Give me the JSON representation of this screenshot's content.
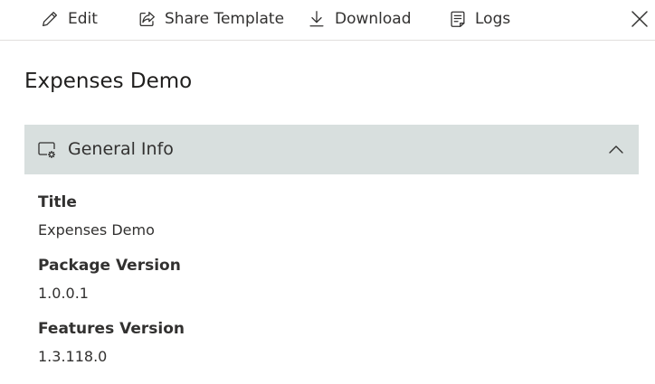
{
  "toolbar": {
    "edit_label": "Edit",
    "share_label": "Share Template",
    "download_label": "Download",
    "logs_label": "Logs",
    "icons": {
      "edit": "pencil-icon",
      "share": "share-icon",
      "download": "download-icon",
      "logs": "logs-icon",
      "close": "close-icon"
    }
  },
  "page": {
    "title": "Expenses Demo"
  },
  "section": {
    "title": "General Info",
    "icon": "settings-window-icon",
    "expanded": true,
    "header_color": "#d8dfde"
  },
  "fields": [
    {
      "label": "Title",
      "value": "Expenses Demo"
    },
    {
      "label": "Package Version",
      "value": "1.0.0.1"
    },
    {
      "label": "Features Version",
      "value": "1.3.118.0"
    }
  ]
}
